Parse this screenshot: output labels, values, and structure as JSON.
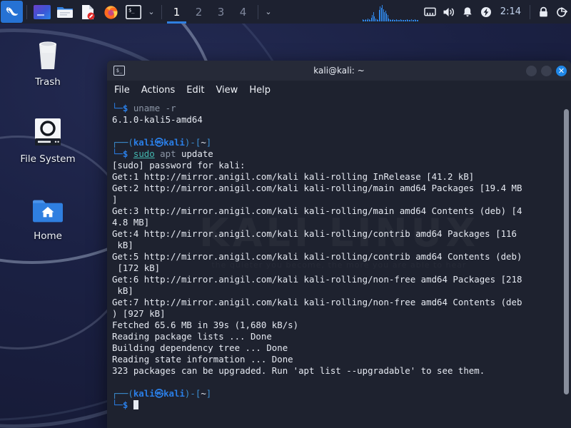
{
  "panel": {
    "kali_menu": "kali-menu",
    "launchers": [
      {
        "name": "app-gradient",
        "label": "Applications"
      },
      {
        "name": "file-manager",
        "label": "File Manager"
      },
      {
        "name": "text-editor",
        "label": "Text Editor"
      },
      {
        "name": "firefox",
        "label": "Firefox"
      },
      {
        "name": "terminal",
        "label": "Terminal"
      }
    ],
    "launcher_chevron": "⌄",
    "workspaces": [
      {
        "label": "1",
        "active": true
      },
      {
        "label": "2",
        "active": false
      },
      {
        "label": "3",
        "active": false
      },
      {
        "label": "4",
        "active": false
      }
    ],
    "workspace_chevron": "⌄",
    "tray": {
      "network_icon": "network-icon",
      "volume_icon": "volume-icon",
      "notification_icon": "bell-icon",
      "power_icon": "power-icon",
      "clock": "2:14",
      "lock_icon": "lock-icon",
      "logout_icon": "logout-icon"
    },
    "sysgraph_bars": [
      3,
      2,
      2,
      3,
      2,
      4,
      3,
      2,
      5,
      9,
      13,
      7,
      4,
      3,
      2,
      16,
      21,
      19,
      23,
      17,
      13,
      15,
      11,
      9,
      4,
      3,
      2,
      2,
      3,
      2,
      2,
      3,
      2,
      2,
      2,
      3,
      2,
      2,
      2,
      2,
      2,
      3,
      2,
      2,
      2,
      3,
      2,
      2,
      3,
      2,
      2,
      2
    ]
  },
  "desktop_icons": [
    {
      "name": "trash",
      "label": "Trash"
    },
    {
      "name": "file-system",
      "label": "File System"
    },
    {
      "name": "home",
      "label": "Home"
    }
  ],
  "terminal": {
    "title": "kali@kali: ~",
    "menu": [
      "File",
      "Actions",
      "Edit",
      "View",
      "Help"
    ],
    "watermark": "KALI LINUX",
    "watermark_tagline": "the quieter you become, the more you are able to hear",
    "prompt": {
      "top_left": "┌──(",
      "user": "kali",
      "at": "㉿",
      "host": "kali",
      "close": ")-[",
      "path": "~",
      "end": "]",
      "bottom": "└─",
      "dollar": "$"
    },
    "lines": [
      {
        "type": "prompt_cmd_simple",
        "dollar": "└─$",
        "cmd": " uname -r"
      },
      {
        "type": "out",
        "text": "6.1.0-kali5-amd64"
      },
      {
        "type": "blank",
        "text": ""
      },
      {
        "type": "prompt_head"
      },
      {
        "type": "prompt_sudo",
        "dollar": "└─$",
        "sudo": "sudo",
        "rest_dim": " apt",
        "rest_white": " update"
      },
      {
        "type": "out",
        "text": "[sudo] password for kali:"
      },
      {
        "type": "out",
        "text": "Get:1 http://mirror.anigil.com/kali kali-rolling InRelease [41.2 kB]"
      },
      {
        "type": "out",
        "text": "Get:2 http://mirror.anigil.com/kali kali-rolling/main amd64 Packages [19.4 MB"
      },
      {
        "type": "out",
        "text": "]"
      },
      {
        "type": "out",
        "text": "Get:3 http://mirror.anigil.com/kali kali-rolling/main amd64 Contents (deb) [4"
      },
      {
        "type": "out",
        "text": "4.8 MB]"
      },
      {
        "type": "out",
        "text": "Get:4 http://mirror.anigil.com/kali kali-rolling/contrib amd64 Packages [116"
      },
      {
        "type": "out",
        "text": " kB]"
      },
      {
        "type": "out",
        "text": "Get:5 http://mirror.anigil.com/kali kali-rolling/contrib amd64 Contents (deb)"
      },
      {
        "type": "out",
        "text": " [172 kB]"
      },
      {
        "type": "out",
        "text": "Get:6 http://mirror.anigil.com/kali kali-rolling/non-free amd64 Packages [218"
      },
      {
        "type": "out",
        "text": " kB]"
      },
      {
        "type": "out",
        "text": "Get:7 http://mirror.anigil.com/kali kali-rolling/non-free amd64 Contents (deb"
      },
      {
        "type": "out",
        "text": ") [927 kB]"
      },
      {
        "type": "out",
        "text": "Fetched 65.6 MB in 39s (1,680 kB/s)"
      },
      {
        "type": "out",
        "text": "Reading package lists ... Done"
      },
      {
        "type": "out",
        "text": "Building dependency tree ... Done"
      },
      {
        "type": "out",
        "text": "Reading state information ... Done"
      },
      {
        "type": "out",
        "text": "323 packages can be upgraded. Run 'apt list --upgradable' to see them."
      },
      {
        "type": "blank",
        "text": ""
      },
      {
        "type": "prompt_head"
      },
      {
        "type": "prompt_cursor",
        "dollar": "└─$"
      }
    ]
  },
  "colors": {
    "accent": "#2f7fe8",
    "panel_bg": "#1d2130",
    "terminal_bg": "#1e222f",
    "titlebar_bg": "#262a38",
    "desktop_bg": "#1b2144",
    "prompt_blue": "#2a7fe8",
    "prompt_cyan": "#43b8b0",
    "close_button": "#1f87e8"
  }
}
